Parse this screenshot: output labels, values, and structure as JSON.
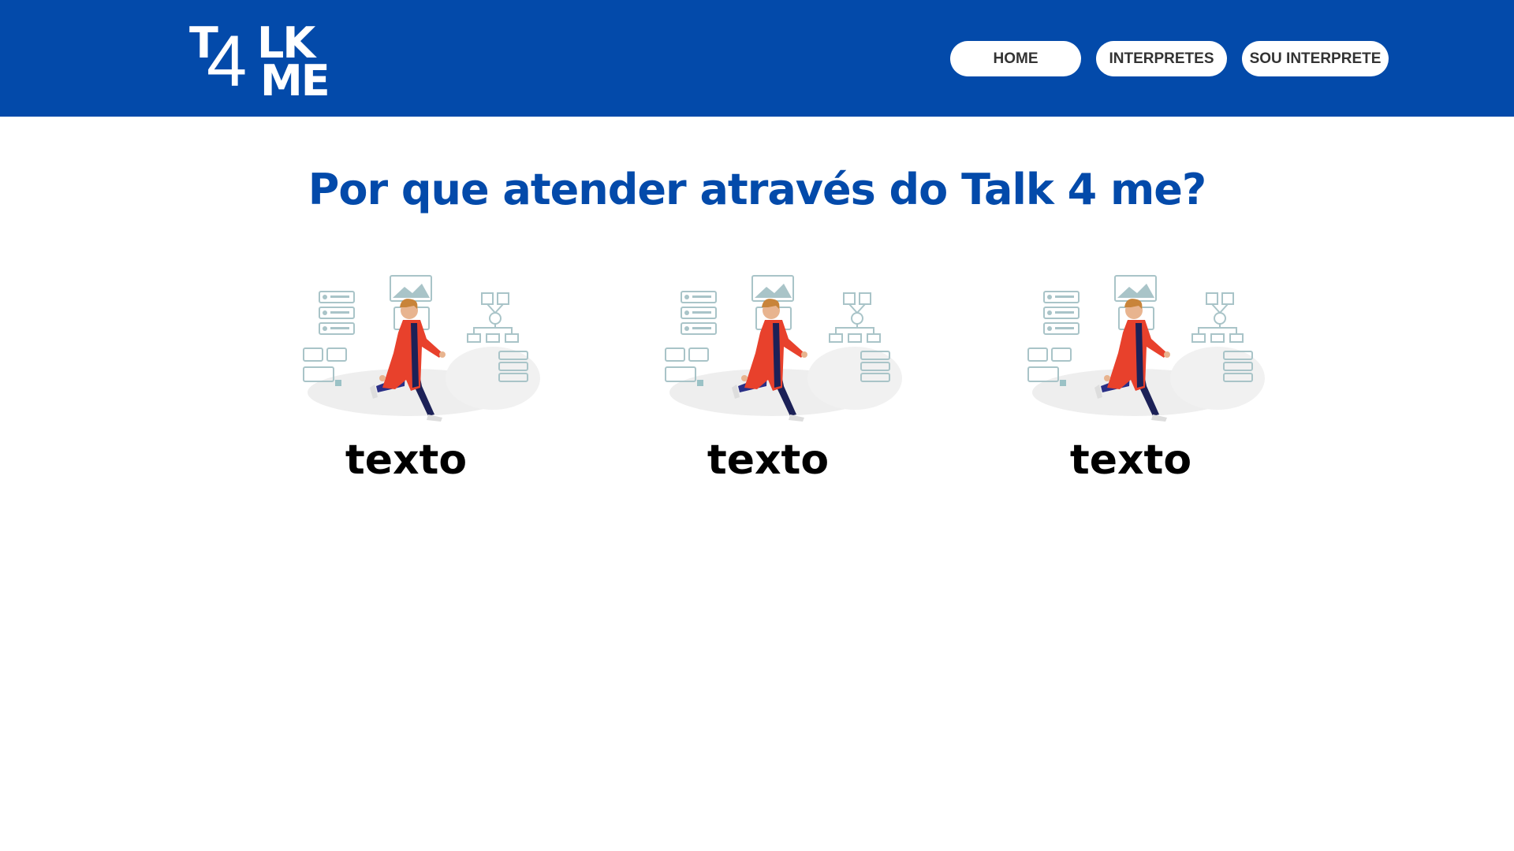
{
  "header": {
    "logo": {
      "line1": "T",
      "digit": "4",
      "line1_rest": "LK",
      "line2": "ME"
    },
    "nav": [
      {
        "label": "HOME"
      },
      {
        "label": "INTERPRETES"
      },
      {
        "label": "SOU INTERPRETE"
      }
    ]
  },
  "main": {
    "title": "Por que atender através do Talk 4 me?",
    "cards": [
      {
        "text": "texto",
        "illustration": "person-walking-illustration"
      },
      {
        "text": "texto",
        "illustration": "person-walking-illustration"
      },
      {
        "text": "texto",
        "illustration": "person-walking-illustration"
      }
    ]
  },
  "colors": {
    "brand_blue": "#034aaa",
    "nav_button_bg": "#ffffff",
    "nav_button_text": "#333333",
    "illustration_red": "#e8412c",
    "illustration_navy": "#1c2157",
    "illustration_teal": "#a9c4c8"
  }
}
